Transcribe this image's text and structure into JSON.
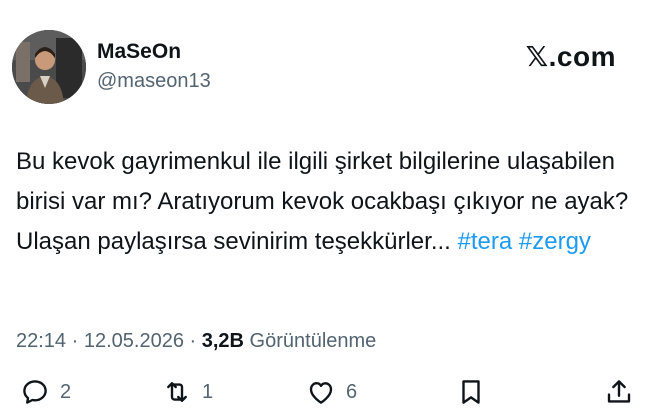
{
  "author": {
    "display_name": "MaSeOn",
    "handle": "@maseon13"
  },
  "brand": {
    "logo": "𝕏",
    "domain": ".com"
  },
  "tweet": {
    "text": "Bu kevok gayrimenkul ile ilgili şirket bilgilerine ulaşabilen birisi var mı? Aratıyorum kevok ocakbaşı çıkıyor ne ayak? Ulaşan paylaşırsa sevinirim teşekkürler...",
    "hashtags": [
      "#tera",
      "#zergy"
    ]
  },
  "meta": {
    "time": "22:14",
    "date": "12.05.2026",
    "views": "3,2B",
    "views_label": "Görüntülenme"
  },
  "actions": {
    "replies": "2",
    "retweets": "1",
    "likes": "6"
  },
  "icons": [
    "reply-icon",
    "retweet-icon",
    "like-icon",
    "bookmark-icon",
    "share-icon"
  ],
  "colors": {
    "link": "#1d9bf0",
    "secondary_text": "#536471",
    "primary_text": "#0f1419"
  }
}
